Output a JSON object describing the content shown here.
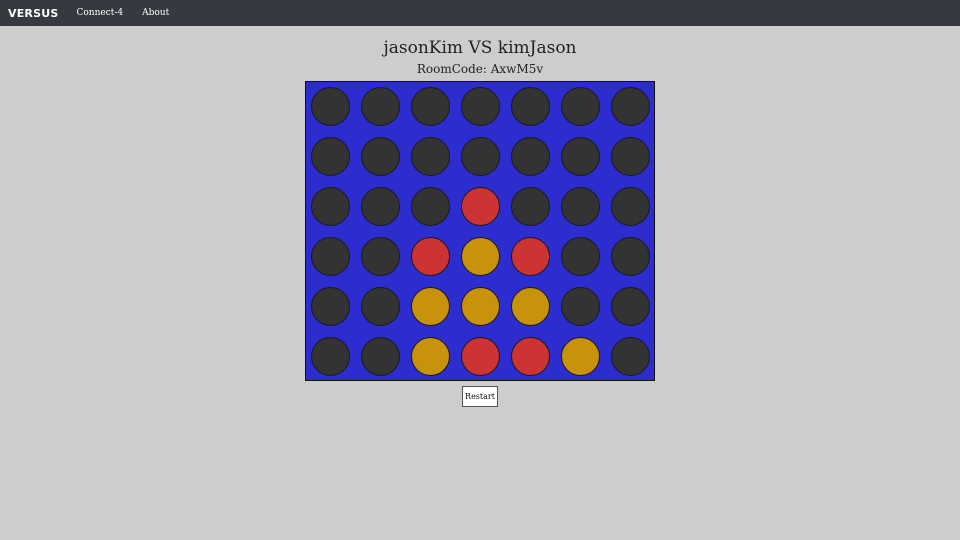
{
  "nav": {
    "brand": "VERSUS",
    "links": [
      "Connect-4",
      "About"
    ]
  },
  "game": {
    "title": "jasonKim VS kimJason",
    "room_code": "RoomCode: AxwM5v",
    "restart_label": "Restart",
    "colors": {
      "empty": "#333333",
      "red": "#cc3333",
      "yellow": "#c8920a",
      "board": "#2c2ccf"
    },
    "board": [
      [
        "empty",
        "empty",
        "empty",
        "empty",
        "empty",
        "empty",
        "empty"
      ],
      [
        "empty",
        "empty",
        "empty",
        "empty",
        "empty",
        "empty",
        "empty"
      ],
      [
        "empty",
        "empty",
        "empty",
        "red",
        "empty",
        "empty",
        "empty"
      ],
      [
        "empty",
        "empty",
        "red",
        "yellow",
        "red",
        "empty",
        "empty"
      ],
      [
        "empty",
        "empty",
        "yellow",
        "yellow",
        "yellow",
        "empty",
        "empty"
      ],
      [
        "empty",
        "empty",
        "yellow",
        "red",
        "red",
        "yellow",
        "empty"
      ]
    ]
  }
}
